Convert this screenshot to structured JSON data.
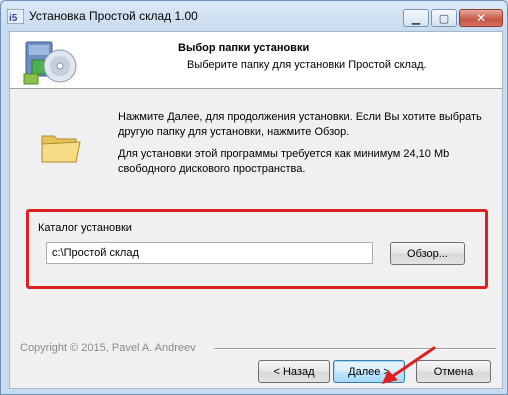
{
  "window": {
    "title": "Установка Простой склад 1.00",
    "controls": {
      "minimize": "▁",
      "maximize": "▢",
      "close": "✕"
    }
  },
  "header": {
    "title": "Выбор папки установки",
    "subtitle": "Выберите папку для установки Простой склад."
  },
  "body": {
    "instruction": "Нажмите Далее, для продолжения установки. Если Вы хотите выбрать другую папку для установки, нажмите Обзор.",
    "space_required": "Для установки этой программы требуется как минимум 24,10 Mb свободного дискового пространства."
  },
  "directory": {
    "label": "Каталог установки",
    "value": "c:\\Простой склад",
    "browse_label": "Обзор..."
  },
  "footer": {
    "copyright": "Copyright © 2015, Pavel A. Andreev",
    "back_label": "< Назад",
    "next_label": "Далее >",
    "cancel_label": "Отмена"
  },
  "icons": {
    "app": "installer-app-icon",
    "header_logo": "install-disk-icon",
    "folder": "folder-icon",
    "annotation": "red-arrow-icon"
  },
  "colors": {
    "highlight": "#e02020",
    "arrow": "#e02020",
    "default_button_border": "#3c7fb1"
  }
}
